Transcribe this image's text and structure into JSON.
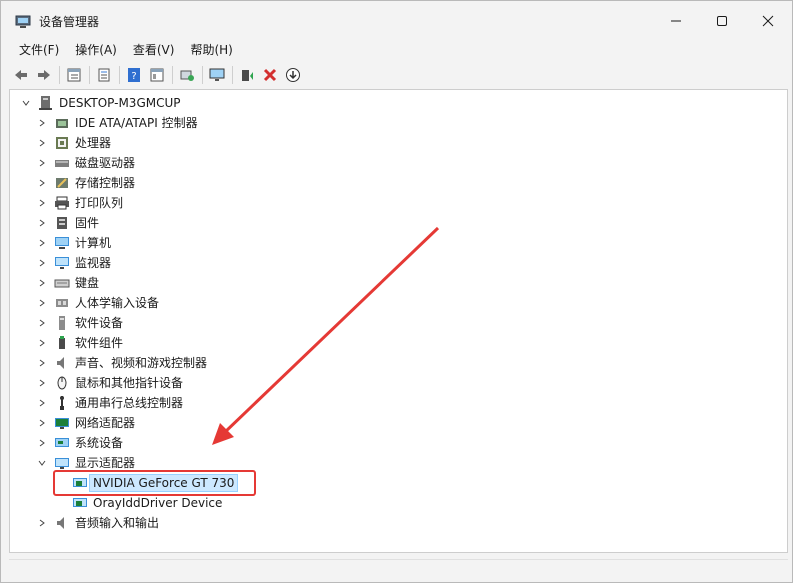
{
  "window": {
    "title": "设备管理器"
  },
  "menu": [
    "文件(F)",
    "操作(A)",
    "查看(V)",
    "帮助(H)"
  ],
  "toolbar_icons": [
    "back-icon",
    "forward-icon",
    "properties-icon",
    "list-icon",
    "help-icon",
    "view-icon",
    "scan-icon",
    "monitor-icon",
    "update-driver-icon",
    "uninstall-icon",
    "disable-icon"
  ],
  "tree": {
    "root": "DESKTOP-M3GMCUP",
    "items": [
      {
        "label": "IDE ATA/ATAPI 控制器",
        "icon": "ide-controller-icon"
      },
      {
        "label": "处理器",
        "icon": "processor-icon"
      },
      {
        "label": "磁盘驱动器",
        "icon": "disk-drive-icon"
      },
      {
        "label": "存储控制器",
        "icon": "storage-controller-icon"
      },
      {
        "label": "打印队列",
        "icon": "printer-icon"
      },
      {
        "label": "固件",
        "icon": "firmware-icon"
      },
      {
        "label": "计算机",
        "icon": "computer-icon"
      },
      {
        "label": "监视器",
        "icon": "monitor-icon"
      },
      {
        "label": "键盘",
        "icon": "keyboard-icon"
      },
      {
        "label": "人体学输入设备",
        "icon": "hid-icon"
      },
      {
        "label": "软件设备",
        "icon": "software-device-icon"
      },
      {
        "label": "软件组件",
        "icon": "software-component-icon"
      },
      {
        "label": "声音、视频和游戏控制器",
        "icon": "sound-icon"
      },
      {
        "label": "鼠标和其他指针设备",
        "icon": "mouse-icon"
      },
      {
        "label": "通用串行总线控制器",
        "icon": "usb-icon"
      },
      {
        "label": "网络适配器",
        "icon": "network-adapter-icon"
      },
      {
        "label": "系统设备",
        "icon": "system-device-icon"
      },
      {
        "label": "显示适配器",
        "icon": "display-adapter-icon",
        "expanded": true,
        "children": [
          {
            "label": "NVIDIA GeForce GT 730",
            "selected": true
          },
          {
            "label": "OrayIddDriver Device"
          }
        ]
      },
      {
        "label": "音频输入和输出",
        "icon": "audio-icon"
      }
    ]
  },
  "colors": {
    "annotation": "#e53935",
    "selection": "#cce8ff",
    "window_bg": "#f3f3f3"
  }
}
